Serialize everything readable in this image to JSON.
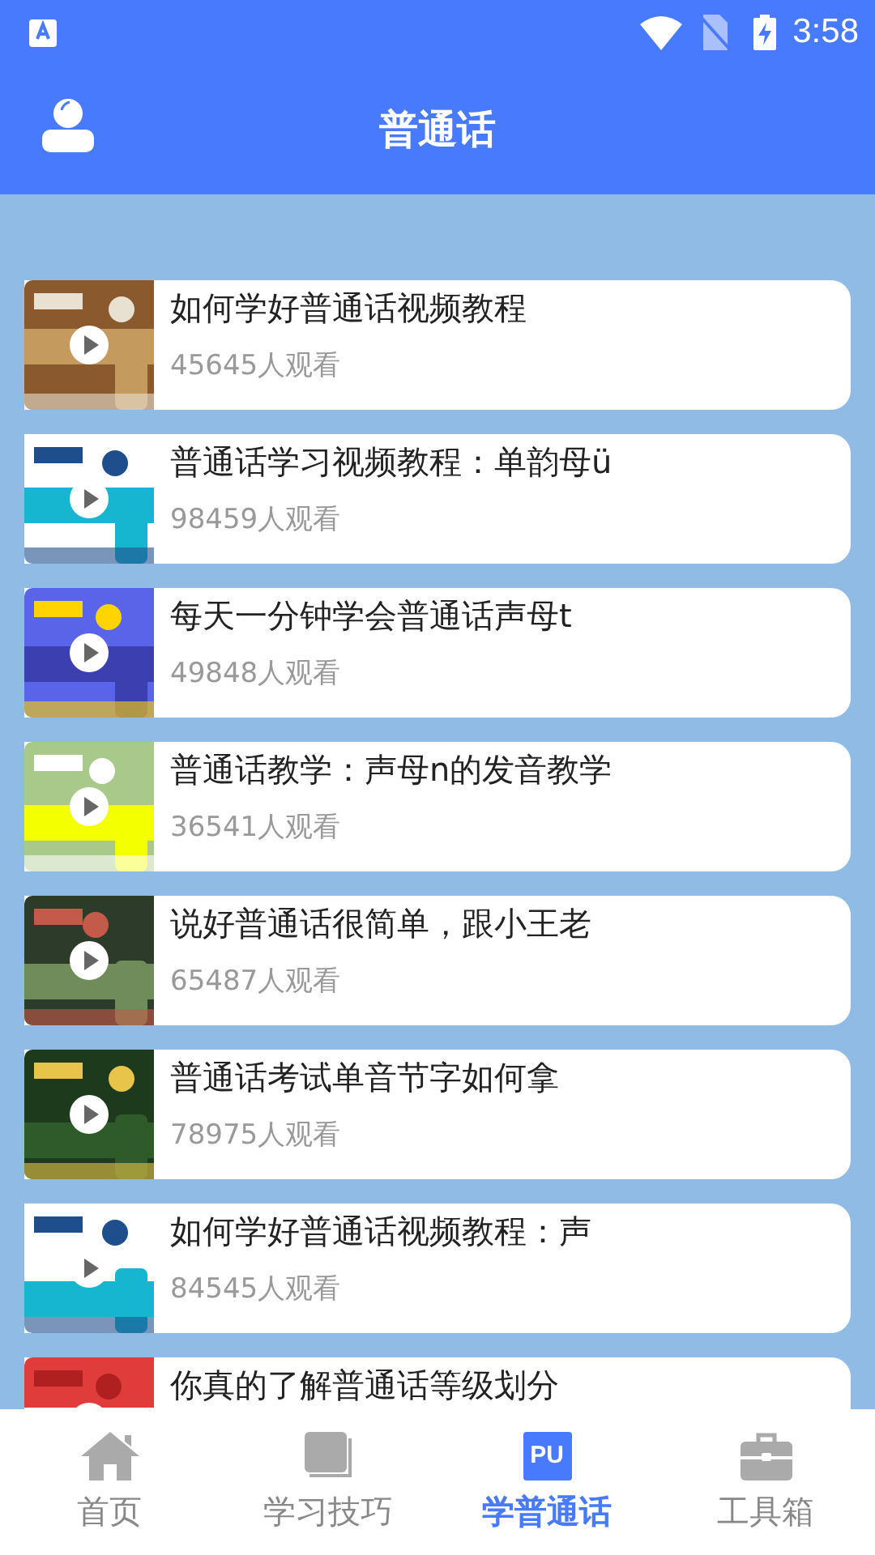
{
  "status_bar": {
    "time": "3:58"
  },
  "app_bar": {
    "title": "普通话"
  },
  "videos": [
    {
      "title": "如何学好普通话视频教程",
      "views": "45645人观看"
    },
    {
      "title": "普通话学习视频教程：单韵母ü",
      "views": "98459人观看"
    },
    {
      "title": "每天一分钟学会普通话声母t",
      "views": "49848人观看"
    },
    {
      "title": "普通话教学：声母n的发音教学",
      "views": "36541人观看"
    },
    {
      "title": "说好普通话很简单，跟小王老",
      "views": "65487人观看"
    },
    {
      "title": "普通话考试单音节字如何拿",
      "views": "78975人观看"
    },
    {
      "title": "如何学好普通话视频教程：声",
      "views": "84545人观看"
    },
    {
      "title": "你真的了解普通话等级划分"
    }
  ],
  "bottom_nav": [
    {
      "label": "首页",
      "selected": false
    },
    {
      "label": "学习技巧",
      "selected": false
    },
    {
      "label": "学普通话",
      "icon_text": "PU",
      "selected": true
    },
    {
      "label": "工具箱",
      "selected": false
    }
  ]
}
